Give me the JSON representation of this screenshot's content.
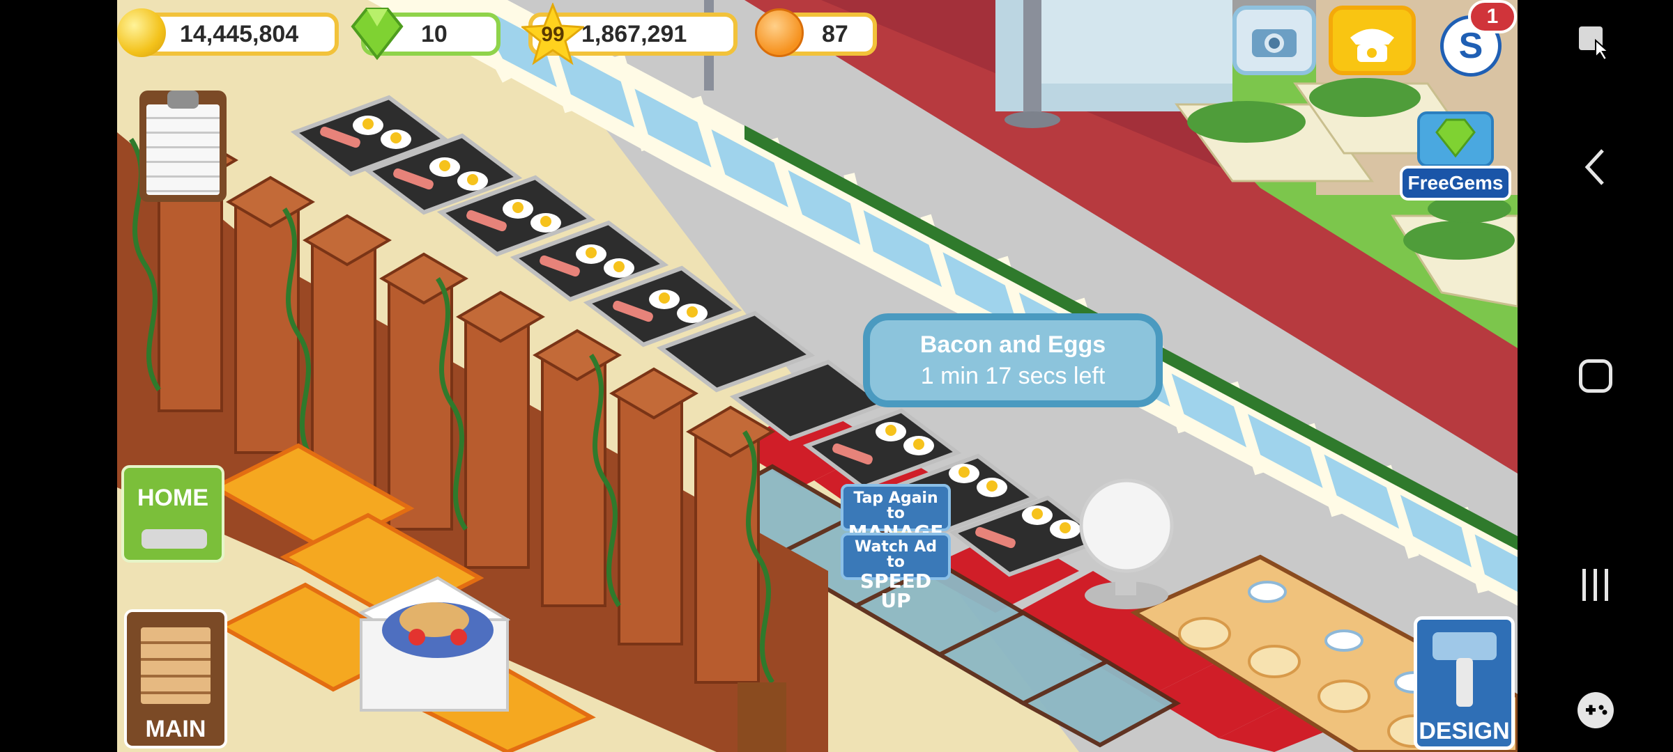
{
  "hud": {
    "coins": "14,445,804",
    "gems": "10",
    "level": "99",
    "xp": "1,867,291",
    "happiness": "87"
  },
  "notification_badge": "1",
  "free_gems_label": "FreeGems",
  "home_label": "HOME",
  "main_label": "MAIN",
  "design_label": "DESIGN",
  "cooking": {
    "dish": "Bacon and Eggs",
    "time_left": "1 min 17 secs left"
  },
  "tap_manage": {
    "line1": "Tap Again to",
    "line2": "MANAGE"
  },
  "speed_up": {
    "line1": "Watch Ad to",
    "line2": "SPEED UP"
  },
  "colors": {
    "coin_border": "#f2c23a",
    "gem_border": "#8fd34a",
    "bubble": "#8cc4dc",
    "carpet_red": "#d01e28",
    "wall_wood": "#a4532a"
  }
}
